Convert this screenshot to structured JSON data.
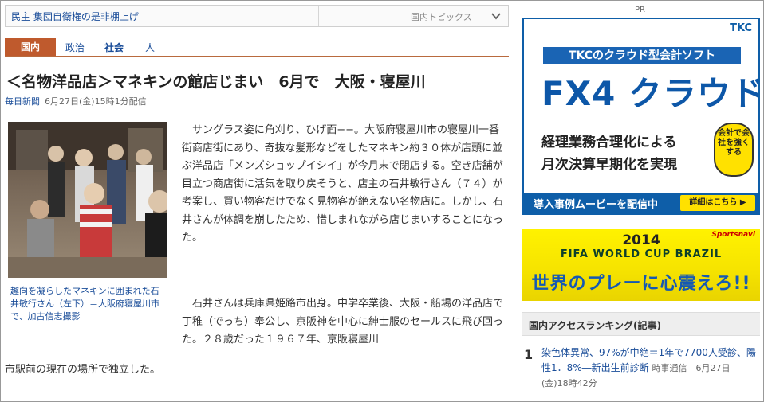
{
  "topics": {
    "headline": "民主 集団自衛権の是非棚上げ",
    "label": "国内トピックス"
  },
  "tabs": [
    {
      "label": "国内",
      "active": true
    },
    {
      "label": "政治",
      "active": false
    },
    {
      "label": "社会",
      "active": false
    },
    {
      "label": "人",
      "active": false
    }
  ],
  "article": {
    "title": "＜名物洋品店＞マネキンの館店じまい　6月で　大阪・寝屋川",
    "source": "毎日新聞",
    "date": "6月27日(金)15時1分配信",
    "photo_caption": "趣向を凝らしたマネキンに囲まれた石井敏行さん（左下）＝大阪府寝屋川市で、加古信志撮影",
    "paragraph1": "サングラス姿に角刈り、ひげ面−−。大阪府寝屋川市の寝屋川一番街商店街にあり、奇抜な髪形などをしたマネキン約３０体が店頭に並ぶ洋品店「メンズショップイシイ」が今月末で閉店する。空き店舗が目立つ商店街に活気を取り戻そうと、店主の石井敏行さん（７４）が考案し、買い物客だけでなく見物客が絶えない名物店に。しかし、石井さんが体調を崩したため、惜しまれながら店じまいすることになった。",
    "paragraph2": "石井さんは兵庫県姫路市出身。中学卒業後、大阪・船場の洋品店で丁稚（でっち）奉公し、京阪神を中心に紳士服のセールスに飛び回った。２８歳だった１９６７年、京阪寝屋川",
    "paragraph2_tail": "市駅前の現在の場所で独立した。"
  },
  "sidebar": {
    "pr_label": "PR",
    "ad_tkc": {
      "brand": "TKC",
      "banner": "TKCのクラウド型会計ソフト",
      "product": "FX4 クラウド",
      "copy1": "経理業務合理化による",
      "copy2": "月次決算早期化を実現",
      "badge": "会計で会社を強くする",
      "strip": "導入事例ムービーを配信中",
      "more": "詳細はこちら ▶"
    },
    "ad_fifa": {
      "sponsor": "Sportsnavi",
      "year": "2014",
      "event": "FIFA WORLD CUP BRAZIL",
      "headline": "世界のプレーに心震えろ!!"
    },
    "ranking": {
      "header": "国内アクセスランキング(記事)",
      "items": [
        {
          "rank": "1",
          "title": "染色体異常、97%が中絶＝1年で7700人受診、陽性1．8%―新出生前診断",
          "meta": "時事通信　6月27日(金)18時42分"
        }
      ]
    }
  },
  "colors": {
    "link": "#1a4d99",
    "tab_active": "#bf5a2d",
    "tkc_blue": "#0e5ea8",
    "fifa_yellow": "#fff200"
  }
}
